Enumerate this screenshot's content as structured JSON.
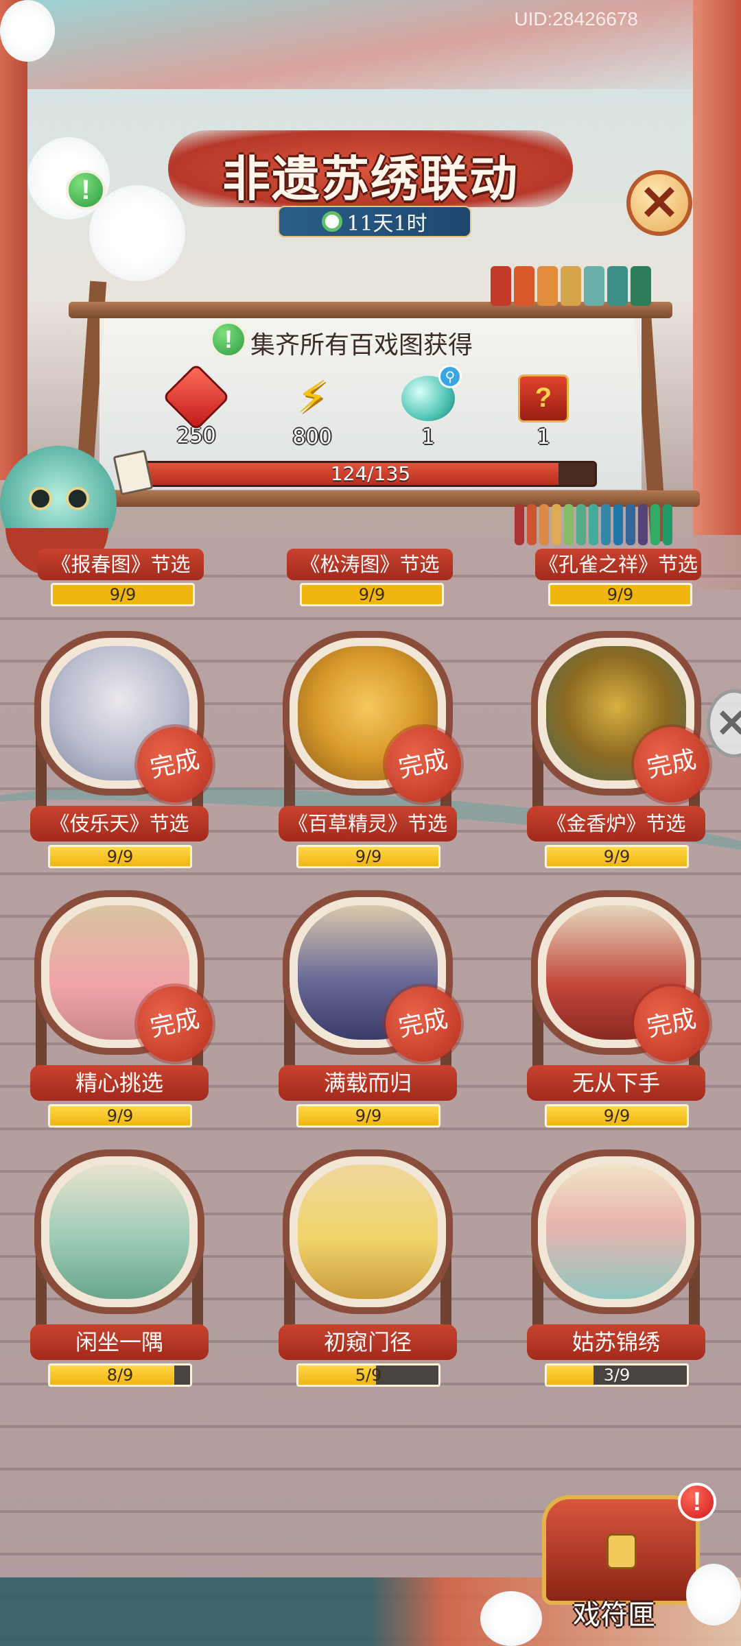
{
  "header": {
    "uid": "UID:28426678",
    "title": "非遗苏绣联动",
    "timer": "11天1时"
  },
  "reward_panel": {
    "label": "集齐所有百戏图获得",
    "rewards": [
      {
        "icon": "red-gem-icon",
        "amount": "250"
      },
      {
        "icon": "lightning-bolt-icon",
        "amount": "800"
      },
      {
        "icon": "magnify-orb-icon",
        "amount": "1"
      },
      {
        "icon": "mystery-box-icon",
        "amount": "1"
      }
    ],
    "progress_text": "124/135",
    "progress_value": 124,
    "progress_max": 135
  },
  "top_row": [
    {
      "label": "《报春图》节选",
      "progress": "9/9"
    },
    {
      "label": "《松涛图》节选",
      "progress": "9/9"
    },
    {
      "label": "《孔雀之祥》节选",
      "progress": "9/9"
    }
  ],
  "items": [
    {
      "label": "《伎乐天》节选",
      "progress": "9/9",
      "ratio": 1,
      "done": "完成"
    },
    {
      "label": "《百草精灵》节选",
      "progress": "9/9",
      "ratio": 1,
      "done": "完成"
    },
    {
      "label": "《金香炉》节选",
      "progress": "9/9",
      "ratio": 1,
      "done": "完成"
    },
    {
      "label": "精心挑选",
      "progress": "9/9",
      "ratio": 1,
      "done": "完成"
    },
    {
      "label": "满载而归",
      "progress": "9/9",
      "ratio": 1,
      "done": "完成"
    },
    {
      "label": "无从下手",
      "progress": "9/9",
      "ratio": 1,
      "done": "完成"
    },
    {
      "label": "闲坐一隅",
      "progress": "8/9",
      "ratio": 0.889,
      "done": ""
    },
    {
      "label": "初窥门径",
      "progress": "5/9",
      "ratio": 0.556,
      "done": ""
    },
    {
      "label": "姑苏锦绣",
      "progress": "3/9",
      "ratio": 0.333,
      "done": ""
    }
  ],
  "chest": {
    "label": "戏符匣",
    "alert": "!"
  },
  "colors": {
    "accent_red": "#b7382a",
    "progress_yellow": "#f0b50f",
    "timer_blue": "#1d4770",
    "info_green": "#2e9a45"
  }
}
